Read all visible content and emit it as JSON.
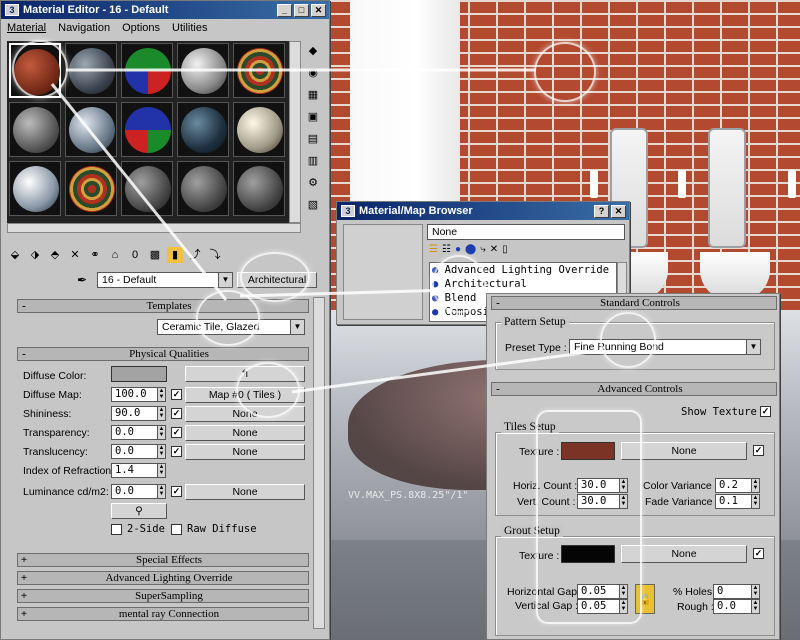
{
  "scene": {
    "caption": "VV.MAX_PS.8X8.25\"/1\""
  },
  "material_editor": {
    "title": "Material Editor - 16 - Default",
    "menu": [
      "Material",
      "Navigation",
      "Options",
      "Utilities"
    ],
    "material_name": "16 - Default",
    "material_type": "Architectural",
    "rollouts": {
      "templates": "Templates",
      "physical": "Physical Qualities",
      "special": "Special Effects",
      "advanced_lighting": "Advanced Lighting Override",
      "supersampling": "SuperSampling",
      "mental_ray": "mental ray Connection"
    },
    "template_value": "Ceramic Tile, Glazed",
    "fields": {
      "diffuse_color_label": "Diffuse Color:",
      "diffuse_map_label": "Diffuse Map:",
      "diffuse_map_value": "100.0",
      "diffuse_map_button": "Map #0   ( Tiles )",
      "shininess_label": "Shininess:",
      "shininess_value": "90.0",
      "transparency_label": "Transparency:",
      "transparency_value": "0.0",
      "translucency_label": "Translucency:",
      "translucency_value": "0.0",
      "ior_label": "Index of Refraction:",
      "ior_value": "1.4",
      "luminance_label": "Luminance cd/m2:",
      "luminance_value": "0.0",
      "none": "None",
      "two_side": "2-Side",
      "raw_diffuse": "Raw Diffuse"
    }
  },
  "map_browser": {
    "title": "Material/Map Browser",
    "field_value": "None",
    "items": [
      "Advanced Lighting Override",
      "Architectural",
      "Blend",
      "Composite"
    ]
  },
  "tiles_panel": {
    "standard_controls": "Standard Controls",
    "pattern_setup": "Pattern Setup",
    "preset_label": "Preset Type :",
    "preset_value": "Fine Running Bond",
    "advanced_controls": "Advanced Controls",
    "show_texture": "Show Texture",
    "tiles_setup": "Tiles Setup",
    "texture_label": "Texture :",
    "none": "None",
    "horiz_count_label": "Horiz. Count :",
    "horiz_count_value": "30.0",
    "vert_count_label": "Vert. Count :",
    "vert_count_value": "30.0",
    "color_variance_label": "Color Variance :",
    "color_variance_value": "0.2",
    "fade_variance_label": "Fade Variance :",
    "fade_variance_value": "0.1",
    "grout_setup": "Grout Setup",
    "horizontal_gap_label": "Horizontal Gap :",
    "horizontal_gap_value": "0.05",
    "vertical_gap_label": "Vertical Gap :",
    "vertical_gap_value": "0.05",
    "holes_label": "% Holes :",
    "holes_value": "0",
    "rough_label": "Rough :",
    "rough_value": "0.0"
  },
  "colors": {
    "tile_texture": "#7a3324",
    "grout_texture": "#050505",
    "diffuse_color": "#a3a3a3"
  }
}
